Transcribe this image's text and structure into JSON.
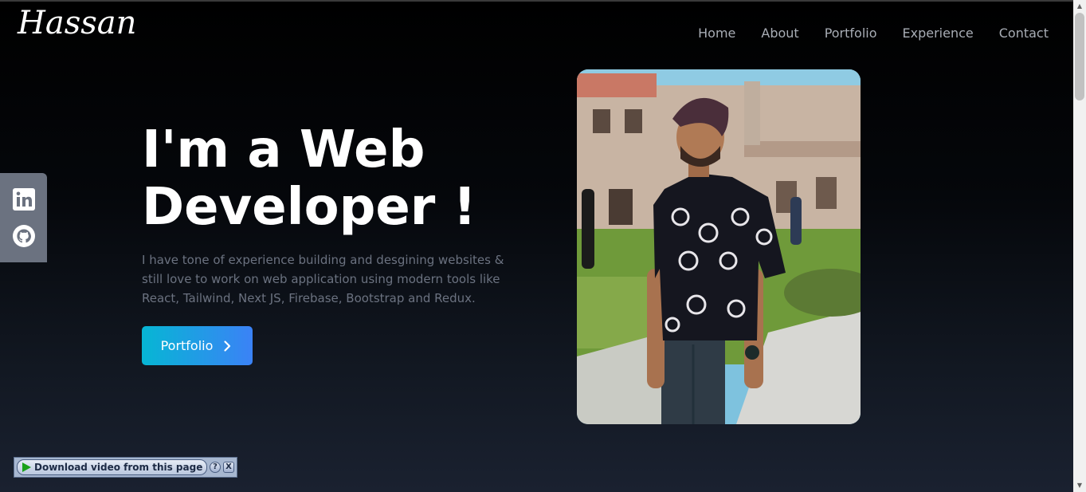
{
  "header": {
    "logo": "Hassan",
    "nav": [
      {
        "label": "Home"
      },
      {
        "label": "About"
      },
      {
        "label": "Portfolio"
      },
      {
        "label": "Experience"
      },
      {
        "label": "Contact"
      }
    ]
  },
  "social": {
    "icons": [
      "linkedin-icon",
      "github-icon"
    ]
  },
  "hero": {
    "title_line1": "I'm a Web",
    "title_line2": "Developer !",
    "description": "I have tone of experience building and desgining websites & still love to work on web application using modern tools like React, Tailwind, Next JS, Firebase, Bootstrap and Redux.",
    "cta_label": "Portfolio",
    "cta_icon": "chevron-right-icon",
    "cta_gradient": [
      "#06b6d4",
      "#3b82f6"
    ]
  },
  "photo": {
    "alt": "portrait photo"
  },
  "download_bar": {
    "label": "Download video from this page",
    "help": "?",
    "close": "X"
  },
  "colors": {
    "background_top": "#000000",
    "background_bottom": "#1a2130",
    "nav_text": "#a8adb5",
    "social_rail": "#6b7280",
    "description_text": "#6b7280"
  }
}
